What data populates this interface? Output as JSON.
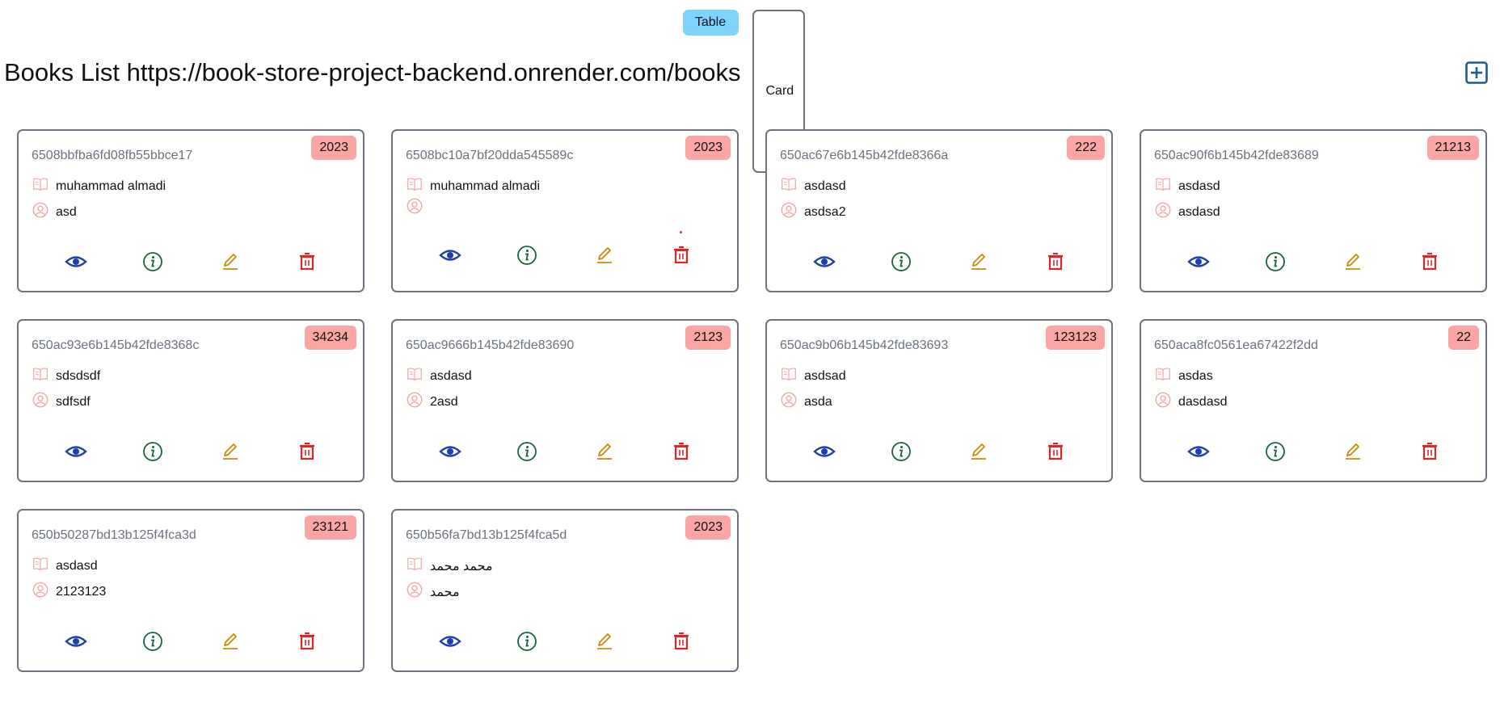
{
  "view_toggle": {
    "table_label": "Table",
    "card_label": "Card"
  },
  "header": {
    "title": "Books List https://book-store-project-backend.onrender.com/books",
    "add_icon": "plus-square-icon"
  },
  "colors": {
    "accent": "#7dd3fc",
    "badge": "#fca5a5",
    "show": "#1e40af",
    "info": "#166534",
    "edit": "#ca8a04",
    "delete": "#dc2626",
    "row_icon": "#f4a5a5"
  },
  "books": [
    {
      "id": "6508bbfba6fd08fb55bbce17",
      "year": "2023",
      "title": "muhammad almadi",
      "author": "asd"
    },
    {
      "id": "6508bc10a7bf20dda545589c",
      "year": "2023",
      "title": "muhammad almadi",
      "author": ""
    },
    {
      "id": "650ac67e6b145b42fde8366a",
      "year": "222",
      "title": "asdasd",
      "author": "asdsa2"
    },
    {
      "id": "650ac90f6b145b42fde83689",
      "year": "21213",
      "title": "asdasd",
      "author": "asdasd"
    },
    {
      "id": "650ac93e6b145b42fde8368c",
      "year": "34234",
      "title": "sdsdsdf",
      "author": "sdfsdf"
    },
    {
      "id": "650ac9666b145b42fde83690",
      "year": "2123",
      "title": "asdasd",
      "author": "2asd"
    },
    {
      "id": "650ac9b06b145b42fde83693",
      "year": "123123",
      "title": "asdsad",
      "author": "asda"
    },
    {
      "id": "650aca8fc0561ea67422f2dd",
      "year": "22",
      "title": "asdas",
      "author": "dasdasd"
    },
    {
      "id": "650b50287bd13b125f4fca3d",
      "year": "23121",
      "title": "asdasd",
      "author": "2123123"
    },
    {
      "id": "650b56fa7bd13b125f4fca5d",
      "year": "2023",
      "title": "محمد محمد",
      "author": "محمد"
    }
  ]
}
